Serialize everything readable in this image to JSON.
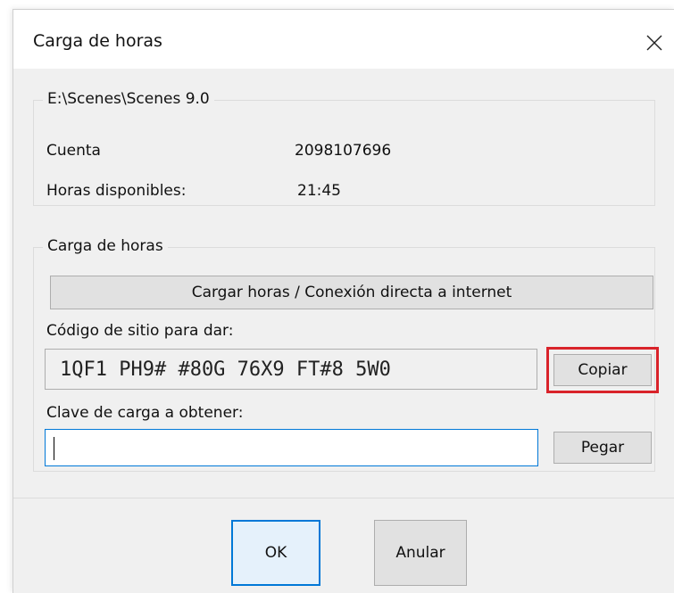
{
  "window": {
    "title": "Carga de horas",
    "close_glyph": "✕"
  },
  "account_group": {
    "legend": "E:\\Scenes\\Scenes 9.0",
    "cuenta_label": "Cuenta",
    "cuenta_value": "2098107696",
    "horas_label": "Horas disponibles:",
    "horas_value": "21:45"
  },
  "load_group": {
    "legend": "Carga de horas",
    "direct_button": "Cargar horas / Conexión directa a internet",
    "site_code_label": "Código de sitio para dar:",
    "site_code_value": "1QF1 PH9# #80G 76X9 FT#8 5W0",
    "copy_button": "Copiar",
    "key_label": "Clave de carga a obtener:",
    "key_value": "",
    "paste_button": "Pegar"
  },
  "footer": {
    "ok_button": "OK",
    "cancel_button": "Anular"
  },
  "colors": {
    "highlight": "#d9232a",
    "focus_border": "#0078d7",
    "dialog_background": "#f0f0f0"
  },
  "icons": {
    "close": "close-icon"
  }
}
